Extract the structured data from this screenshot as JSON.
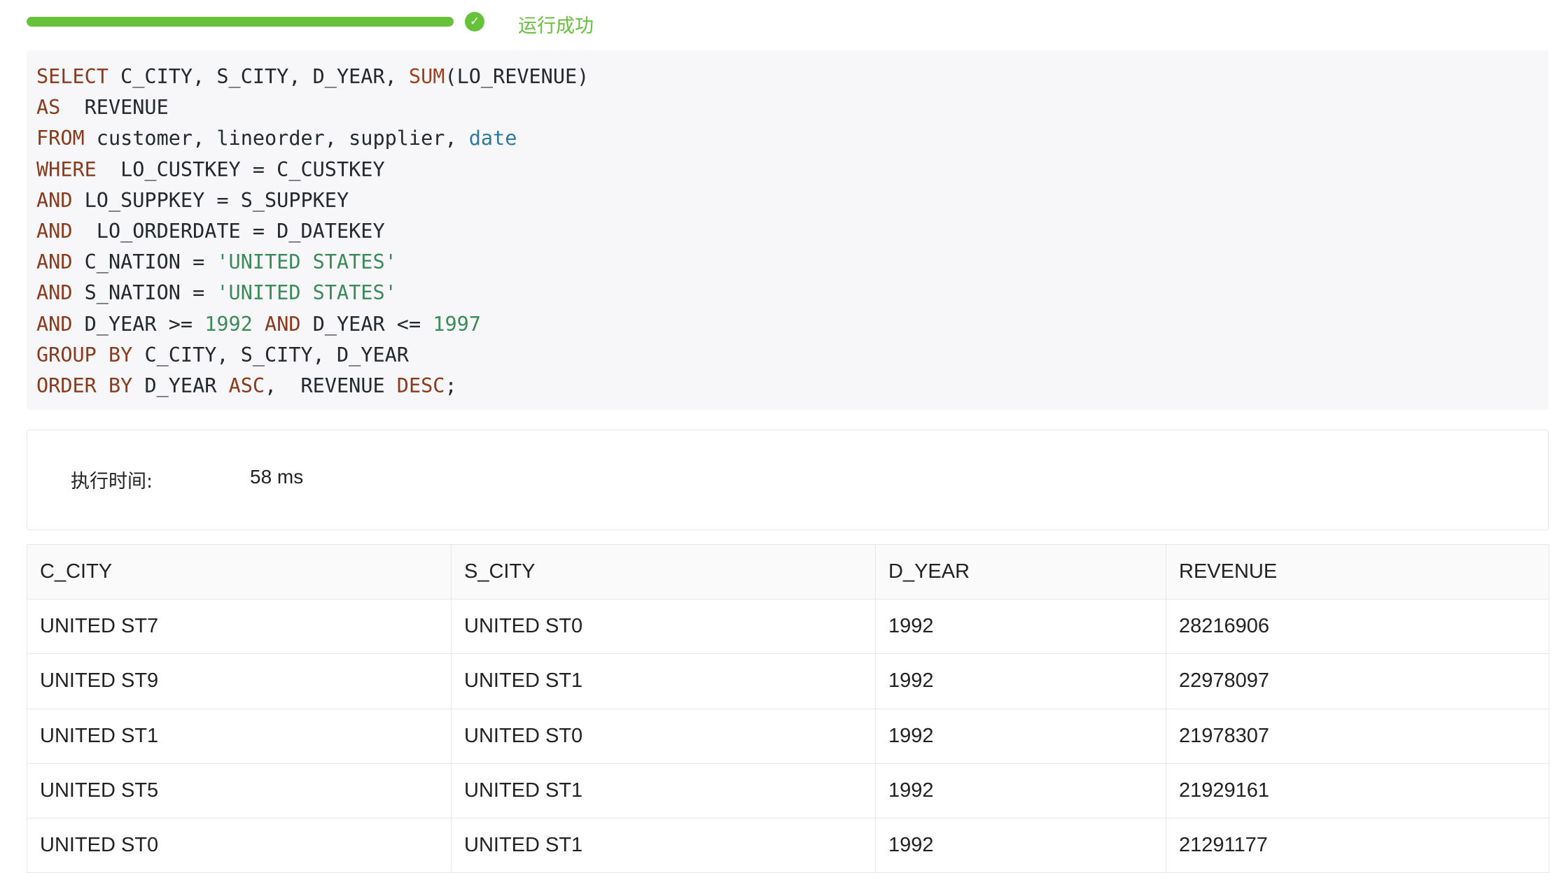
{
  "status": {
    "progress_percent": 100,
    "icon": "check-circle-icon",
    "text": "运行成功",
    "color": "#67c23a"
  },
  "sql": {
    "lines": [
      [
        {
          "t": "kw",
          "v": "SELECT"
        },
        {
          "t": "plain",
          "v": " C_CITY, S_CITY, D_YEAR, "
        },
        {
          "t": "fn",
          "v": "SUM"
        },
        {
          "t": "plain",
          "v": "(LO_REVENUE)"
        }
      ],
      [
        {
          "t": "kw",
          "v": "AS"
        },
        {
          "t": "plain",
          "v": "  REVENUE"
        }
      ],
      [
        {
          "t": "kw",
          "v": "FROM"
        },
        {
          "t": "plain",
          "v": " customer, lineorder, supplier, "
        },
        {
          "t": "type",
          "v": "date"
        }
      ],
      [
        {
          "t": "kw",
          "v": "WHERE"
        },
        {
          "t": "plain",
          "v": "  LO_CUSTKEY = C_CUSTKEY"
        }
      ],
      [
        {
          "t": "kw",
          "v": "AND"
        },
        {
          "t": "plain",
          "v": " LO_SUPPKEY = S_SUPPKEY"
        }
      ],
      [
        {
          "t": "kw",
          "v": "AND"
        },
        {
          "t": "plain",
          "v": "  LO_ORDERDATE = D_DATEKEY"
        }
      ],
      [
        {
          "t": "kw",
          "v": "AND"
        },
        {
          "t": "plain",
          "v": " C_NATION = "
        },
        {
          "t": "str",
          "v": "'UNITED STATES'"
        }
      ],
      [
        {
          "t": "kw",
          "v": "AND"
        },
        {
          "t": "plain",
          "v": " S_NATION = "
        },
        {
          "t": "str",
          "v": "'UNITED STATES'"
        }
      ],
      [
        {
          "t": "kw",
          "v": "AND"
        },
        {
          "t": "plain",
          "v": " D_YEAR >= "
        },
        {
          "t": "num",
          "v": "1992"
        },
        {
          "t": "plain",
          "v": " "
        },
        {
          "t": "kw",
          "v": "AND"
        },
        {
          "t": "plain",
          "v": " D_YEAR <= "
        },
        {
          "t": "num",
          "v": "1997"
        }
      ],
      [
        {
          "t": "kw",
          "v": "GROUP BY"
        },
        {
          "t": "plain",
          "v": " C_CITY, S_CITY, D_YEAR"
        }
      ],
      [
        {
          "t": "kw",
          "v": "ORDER BY"
        },
        {
          "t": "plain",
          "v": " D_YEAR "
        },
        {
          "t": "kw",
          "v": "ASC"
        },
        {
          "t": "plain",
          "v": ",  REVENUE "
        },
        {
          "t": "kw",
          "v": "DESC"
        },
        {
          "t": "plain",
          "v": ";"
        }
      ]
    ],
    "colors": {
      "keyword": "#8b3a1c",
      "string": "#3c8a5a",
      "number": "#3c8a5a",
      "type": "#2b7a9c"
    }
  },
  "exec": {
    "label": "执行时间:",
    "value": "58 ms"
  },
  "results": {
    "columns": [
      "C_CITY",
      "S_CITY",
      "D_YEAR",
      "REVENUE"
    ],
    "rows": [
      [
        "UNITED ST7",
        "UNITED ST0",
        "1992",
        "28216906"
      ],
      [
        "UNITED ST9",
        "UNITED ST1",
        "1992",
        "22978097"
      ],
      [
        "UNITED ST1",
        "UNITED ST0",
        "1992",
        "21978307"
      ],
      [
        "UNITED ST5",
        "UNITED ST1",
        "1992",
        "21929161"
      ],
      [
        "UNITED ST0",
        "UNITED ST1",
        "1992",
        "21291177"
      ]
    ]
  }
}
